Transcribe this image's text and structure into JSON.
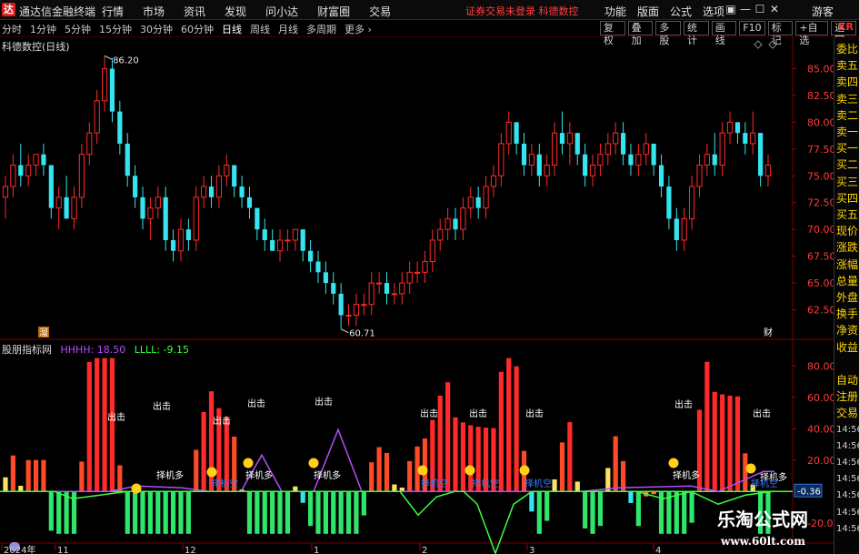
{
  "titlebar": {
    "logo": "达",
    "app_title": "通达信金融终端",
    "menu": [
      "行情",
      "市场",
      "资讯",
      "发现",
      "问小达",
      "财富圈",
      "交易"
    ],
    "notice": "证券交易未登录  科德数控",
    "right_menu": [
      "功能",
      "版面",
      "公式",
      "选项"
    ],
    "window_controls": [
      "▣",
      "—",
      "☐",
      "✕"
    ],
    "guest": "游客"
  },
  "toolbar": {
    "periods": [
      "分时",
      "1分钟",
      "5分钟",
      "15分钟",
      "30分钟",
      "60分钟",
      "日线",
      "周线",
      "月线",
      "多周期",
      "更多 ›"
    ],
    "active_period": "日线",
    "right_tools": [
      "复权",
      "叠加",
      "多股",
      "统计",
      "画线",
      "F10",
      "标记",
      "+自选",
      "返回"
    ],
    "kr_tag": "KR"
  },
  "main_chart": {
    "title": "科德数控(日线)",
    "high_label": "86.20",
    "low_label": "60.71",
    "y_ticks": [
      "85.00",
      "82.50",
      "80.00",
      "77.50",
      "75.00",
      "72.50",
      "70.00",
      "67.50",
      "65.00",
      "62.50"
    ],
    "markers": [
      "溜",
      "财"
    ]
  },
  "indicator": {
    "name": "股朋指标网",
    "hhhh_label": "HHHH: 18.50",
    "llll_label": "LLLL: -9.15",
    "y_ticks": [
      "80.00",
      "60.00",
      "40.00",
      "20.00",
      "",
      "-20.00"
    ],
    "current_value": "-0.36",
    "signal_chuji": "出击",
    "signal_zeji": "择机多",
    "signal_zeji_kong": "择机空"
  },
  "x_axis": [
    "2024年",
    "11",
    "12",
    "1",
    "2",
    "3",
    "4"
  ],
  "sidebar": {
    "items": [
      "委比",
      "卖五",
      "卖四",
      "卖三",
      "卖二",
      "卖一",
      "买一",
      "买二",
      "买三",
      "买四",
      "买五",
      "现价",
      "涨跌",
      "涨幅",
      "总量",
      "外盘",
      "换手",
      "净资",
      "收益",
      "",
      "自动",
      "注册",
      "交易",
      "14:56",
      "14:56",
      "14:56",
      "14:56",
      "14:56",
      "14:56",
      "14:56"
    ]
  },
  "watermark": {
    "line1": "乐淘公式网",
    "line2": "www.60lt.com"
  },
  "colors": {
    "up": "#ff2a2a",
    "down": "#35e4ef",
    "grid": "#7a0000",
    "hhhh": "#b44dff",
    "llll": "#3cff3c"
  },
  "chart_data": {
    "type": "candlestick",
    "title": "科德数控(日线)",
    "ylim": [
      60,
      87
    ],
    "candles": [
      [
        73,
        75,
        71,
        74
      ],
      [
        74,
        77,
        73,
        76
      ],
      [
        76,
        78,
        74,
        75
      ],
      [
        75,
        77,
        74,
        76
      ],
      [
        76,
        77,
        75,
        77
      ],
      [
        77,
        78,
        75,
        76
      ],
      [
        76,
        76,
        71,
        72
      ],
      [
        72,
        74,
        70,
        73
      ],
      [
        73,
        75,
        71,
        71
      ],
      [
        71,
        74,
        70,
        73
      ],
      [
        73,
        78,
        72,
        77
      ],
      [
        77,
        80,
        76,
        79
      ],
      [
        79,
        83,
        78,
        82
      ],
      [
        82,
        86.2,
        81,
        85
      ],
      [
        85,
        86,
        80,
        81
      ],
      [
        81,
        82,
        77,
        78
      ],
      [
        78,
        79,
        74,
        75
      ],
      [
        75,
        76,
        72,
        73
      ],
      [
        73,
        74,
        70,
        71
      ],
      [
        71,
        73,
        69,
        72
      ],
      [
        72,
        74,
        71,
        73
      ],
      [
        73,
        74,
        68,
        69
      ],
      [
        69,
        70,
        67,
        68
      ],
      [
        68,
        71,
        67,
        70
      ],
      [
        70,
        71,
        68,
        69
      ],
      [
        69,
        74,
        68,
        73
      ],
      [
        73,
        75,
        72,
        74
      ],
      [
        74,
        75,
        72,
        73
      ],
      [
        73,
        76,
        72,
        75
      ],
      [
        75,
        77,
        74,
        76
      ],
      [
        76,
        76,
        73,
        74
      ],
      [
        74,
        75,
        72,
        73
      ],
      [
        73,
        74,
        71,
        72
      ],
      [
        72,
        72,
        69,
        70
      ],
      [
        70,
        71,
        68,
        69
      ],
      [
        69,
        70,
        68,
        68
      ],
      [
        68,
        70,
        67,
        69
      ],
      [
        69,
        70,
        68,
        69
      ],
      [
        69,
        70,
        68,
        70
      ],
      [
        70,
        70,
        67,
        68
      ],
      [
        68,
        69,
        66,
        67
      ],
      [
        67,
        68,
        65,
        66
      ],
      [
        66,
        67,
        64,
        65
      ],
      [
        65,
        66,
        63,
        64
      ],
      [
        64,
        65,
        60.71,
        62
      ],
      [
        62,
        63,
        61,
        62
      ],
      [
        62,
        64,
        61,
        63
      ],
      [
        63,
        64,
        62,
        63
      ],
      [
        63,
        66,
        62,
        65
      ],
      [
        65,
        66,
        64,
        65
      ],
      [
        65,
        66,
        63,
        64
      ],
      [
        64,
        65,
        63,
        64
      ],
      [
        64,
        66,
        63,
        65
      ],
      [
        65,
        67,
        64,
        66
      ],
      [
        66,
        67,
        65,
        66
      ],
      [
        66,
        68,
        65,
        67
      ],
      [
        67,
        70,
        66,
        69
      ],
      [
        69,
        71,
        68,
        70
      ],
      [
        70,
        72,
        69,
        71
      ],
      [
        71,
        72,
        69,
        70
      ],
      [
        70,
        73,
        69,
        72
      ],
      [
        72,
        74,
        71,
        73
      ],
      [
        73,
        74,
        71,
        72
      ],
      [
        72,
        75,
        71,
        74
      ],
      [
        74,
        76,
        73,
        75
      ],
      [
        75,
        79,
        74,
        78
      ],
      [
        78,
        81,
        77,
        80
      ],
      [
        80,
        80,
        77,
        78
      ],
      [
        78,
        79,
        75,
        76
      ],
      [
        76,
        78,
        75,
        77
      ],
      [
        77,
        78,
        74,
        75
      ],
      [
        75,
        77,
        74,
        76
      ],
      [
        76,
        80,
        75,
        79
      ],
      [
        79,
        81,
        77,
        78
      ],
      [
        78,
        80,
        76,
        79
      ],
      [
        79,
        79,
        76,
        77
      ],
      [
        77,
        78,
        74,
        75
      ],
      [
        75,
        77,
        74,
        76
      ],
      [
        76,
        78,
        75,
        77
      ],
      [
        77,
        79,
        76,
        78
      ],
      [
        78,
        80,
        77,
        79
      ],
      [
        79,
        80,
        76,
        77
      ],
      [
        77,
        78,
        75,
        76
      ],
      [
        76,
        78,
        75,
        77
      ],
      [
        77,
        79,
        76,
        78
      ],
      [
        78,
        78,
        75,
        76
      ],
      [
        76,
        77,
        73,
        74
      ],
      [
        74,
        75,
        70,
        71
      ],
      [
        71,
        72,
        68,
        69
      ],
      [
        69,
        72,
        68,
        71
      ],
      [
        71,
        75,
        70,
        74
      ],
      [
        74,
        77,
        73,
        76
      ],
      [
        76,
        78,
        75,
        77
      ],
      [
        77,
        79,
        75,
        76
      ],
      [
        76,
        80,
        75,
        79
      ],
      [
        79,
        81,
        78,
        80
      ],
      [
        80,
        80,
        78,
        79
      ],
      [
        79,
        80,
        77,
        78
      ],
      [
        78,
        81,
        77,
        79
      ],
      [
        79,
        79,
        74,
        75
      ],
      [
        75,
        77,
        74,
        76
      ]
    ]
  }
}
